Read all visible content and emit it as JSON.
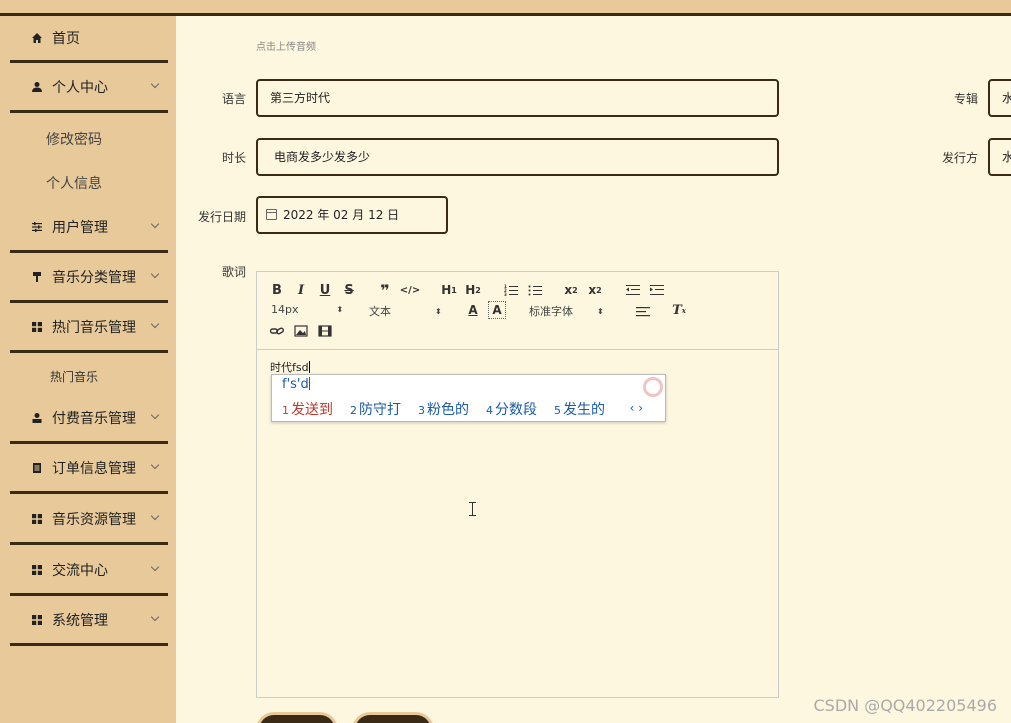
{
  "sidebar": {
    "items": [
      {
        "label": "首页",
        "icon": "home-icon"
      },
      {
        "label": "个人中心",
        "icon": "user-icon"
      },
      {
        "label": "用户管理",
        "icon": "sliders-icon"
      },
      {
        "label": "音乐分类管理",
        "icon": "hammer-icon"
      },
      {
        "label": "热门音乐管理",
        "icon": "grid-icon"
      },
      {
        "label": "付费音乐管理",
        "icon": "person-icon"
      },
      {
        "label": "订单信息管理",
        "icon": "document-icon"
      },
      {
        "label": "音乐资源管理",
        "icon": "grid-icon"
      },
      {
        "label": "交流中心",
        "icon": "grid-icon"
      },
      {
        "label": "系统管理",
        "icon": "grid-icon"
      }
    ],
    "sub_personal": [
      "修改密码",
      "个人信息"
    ],
    "sub_hot": [
      "热门音乐"
    ]
  },
  "form": {
    "upload_hint": "点击上传音频",
    "language_label": "语言",
    "language_value": "第三方时代",
    "duration_label": "时长",
    "duration_value": "电商发多少发多少",
    "release_date_label": "发行日期",
    "release_date_value": "2022 年 02 月 12 日",
    "lyrics_label": "歌词",
    "album_label": "专辑",
    "album_value": "水",
    "publisher_label": "发行方",
    "publisher_value": "水"
  },
  "editor": {
    "font_size": "14px",
    "text_type": "文本",
    "font_family": "标准字体",
    "content": "时代fsd"
  },
  "ime": {
    "input": "f's'd",
    "candidates": [
      {
        "num": "1",
        "text": "发送到"
      },
      {
        "num": "2",
        "text": "防守打"
      },
      {
        "num": "3",
        "text": "粉色的"
      },
      {
        "num": "4",
        "text": "分数段"
      },
      {
        "num": "5",
        "text": "发生的"
      }
    ],
    "nav": "‹ ›"
  },
  "watermark": "CSDN @QQ402205496",
  "colors": {
    "sidebar_bg": "#e8c99a",
    "main_bg": "#fdf7e0",
    "dark_border": "#3a2a16",
    "ime_blue": "#1a5aa8",
    "ime_red": "#c0392b"
  }
}
